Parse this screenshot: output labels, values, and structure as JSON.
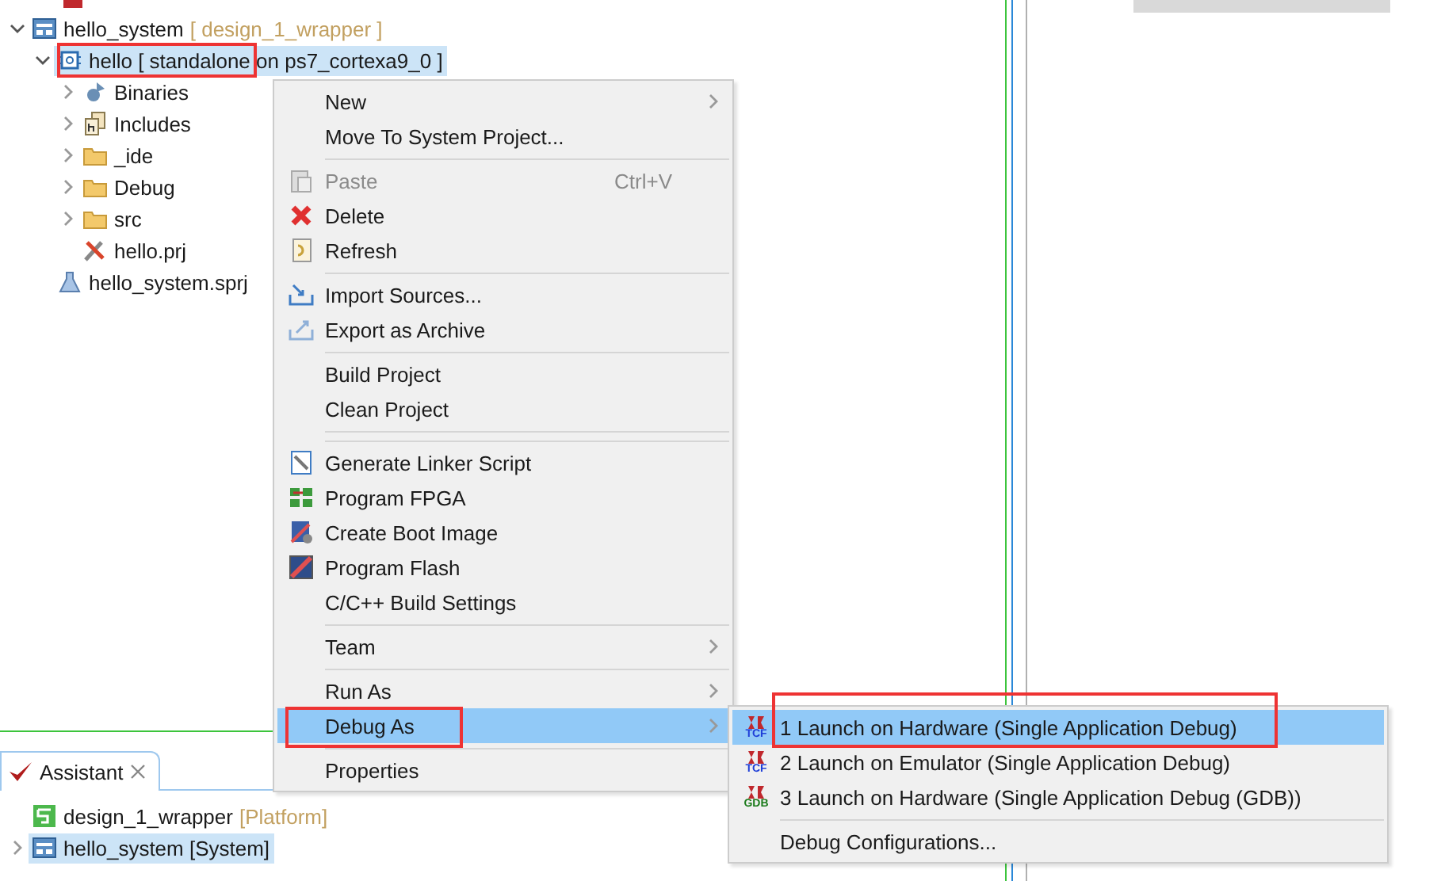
{
  "project_tree": {
    "items": [
      {
        "label": "hello_system",
        "suffix": "[ design_1_wrapper ]",
        "kind": "system",
        "expanded": true,
        "selected": false,
        "children": [
          {
            "label": "hello [ standalone on ps7_cortexa9_0 ]",
            "kind": "app",
            "expanded": true,
            "selected": true,
            "children": [
              {
                "label": "Binaries",
                "kind": "binaries",
                "expanded": false,
                "selected": false
              },
              {
                "label": "Includes",
                "kind": "includes",
                "expanded": false,
                "selected": false
              },
              {
                "label": "_ide",
                "kind": "folder",
                "expanded": false,
                "selected": false
              },
              {
                "label": "Debug",
                "kind": "folder",
                "expanded": false,
                "selected": false
              },
              {
                "label": "src",
                "kind": "folder",
                "expanded": false,
                "selected": false
              },
              {
                "label": "hello.prj",
                "kind": "prj",
                "selected": false
              }
            ]
          },
          {
            "label": "hello_system.sprj",
            "kind": "sprj",
            "selected": false
          }
        ]
      }
    ]
  },
  "assistant": {
    "tab": {
      "label": "Assistant",
      "selected": true
    },
    "items": [
      {
        "label": "design_1_wrapper",
        "suffix": "[Platform]",
        "kind": "platform",
        "selected": false
      },
      {
        "label": "hello_system [System]",
        "kind": "system",
        "expanded": false,
        "selected": true
      }
    ]
  },
  "context_menu": {
    "items": [
      {
        "kind": "item",
        "label": "New",
        "submenu": true,
        "disabled": false,
        "selected": false
      },
      {
        "kind": "item",
        "label": "Move To System Project...",
        "submenu": false,
        "disabled": false,
        "selected": false
      },
      {
        "kind": "separator"
      },
      {
        "kind": "item",
        "label": "Paste",
        "shortcut": "Ctrl+V",
        "submenu": false,
        "disabled": true,
        "selected": false
      },
      {
        "kind": "item",
        "label": "Delete",
        "submenu": false,
        "disabled": false,
        "selected": false
      },
      {
        "kind": "item",
        "label": "Refresh",
        "submenu": false,
        "disabled": false,
        "selected": false
      },
      {
        "kind": "separator"
      },
      {
        "kind": "item",
        "label": "Import Sources...",
        "submenu": false,
        "disabled": false,
        "selected": false
      },
      {
        "kind": "item",
        "label": "Export as Archive",
        "submenu": false,
        "disabled": false,
        "selected": false
      },
      {
        "kind": "separator"
      },
      {
        "kind": "item",
        "label": "Build Project",
        "submenu": false,
        "disabled": false,
        "selected": false
      },
      {
        "kind": "item",
        "label": "Clean Project",
        "submenu": false,
        "disabled": false,
        "selected": false
      },
      {
        "kind": "separator"
      },
      {
        "kind": "separator"
      },
      {
        "kind": "item",
        "label": "Generate Linker Script",
        "submenu": false,
        "disabled": false,
        "selected": false
      },
      {
        "kind": "item",
        "label": "Program FPGA",
        "submenu": false,
        "disabled": false,
        "selected": false
      },
      {
        "kind": "item",
        "label": "Create Boot Image",
        "submenu": false,
        "disabled": false,
        "selected": false
      },
      {
        "kind": "item",
        "label": "Program Flash",
        "submenu": false,
        "disabled": false,
        "selected": false
      },
      {
        "kind": "item",
        "label": "C/C++ Build Settings",
        "submenu": false,
        "disabled": false,
        "selected": false
      },
      {
        "kind": "separator"
      },
      {
        "kind": "item",
        "label": "Team",
        "submenu": true,
        "disabled": false,
        "selected": false
      },
      {
        "kind": "separator"
      },
      {
        "kind": "item",
        "label": "Run As",
        "submenu": true,
        "disabled": false,
        "selected": false
      },
      {
        "kind": "item",
        "label": "Debug As",
        "submenu": true,
        "disabled": false,
        "selected": true
      },
      {
        "kind": "separator"
      },
      {
        "kind": "item",
        "label": "Properties",
        "submenu": false,
        "disabled": false,
        "selected": false
      }
    ]
  },
  "debug_submenu": {
    "items": [
      {
        "kind": "item",
        "label": "1 Launch on Hardware (Single Application Debug)",
        "badge": "TCF",
        "selected": true
      },
      {
        "kind": "item",
        "label": "2 Launch on Emulator (Single Application Debug)",
        "badge": "TCF",
        "selected": false
      },
      {
        "kind": "item",
        "label": "3 Launch on Hardware (Single Application Debug (GDB))",
        "badge": "GDB",
        "selected": false
      },
      {
        "kind": "separator"
      },
      {
        "kind": "item",
        "label": "Debug Configurations...",
        "selected": false
      }
    ]
  }
}
